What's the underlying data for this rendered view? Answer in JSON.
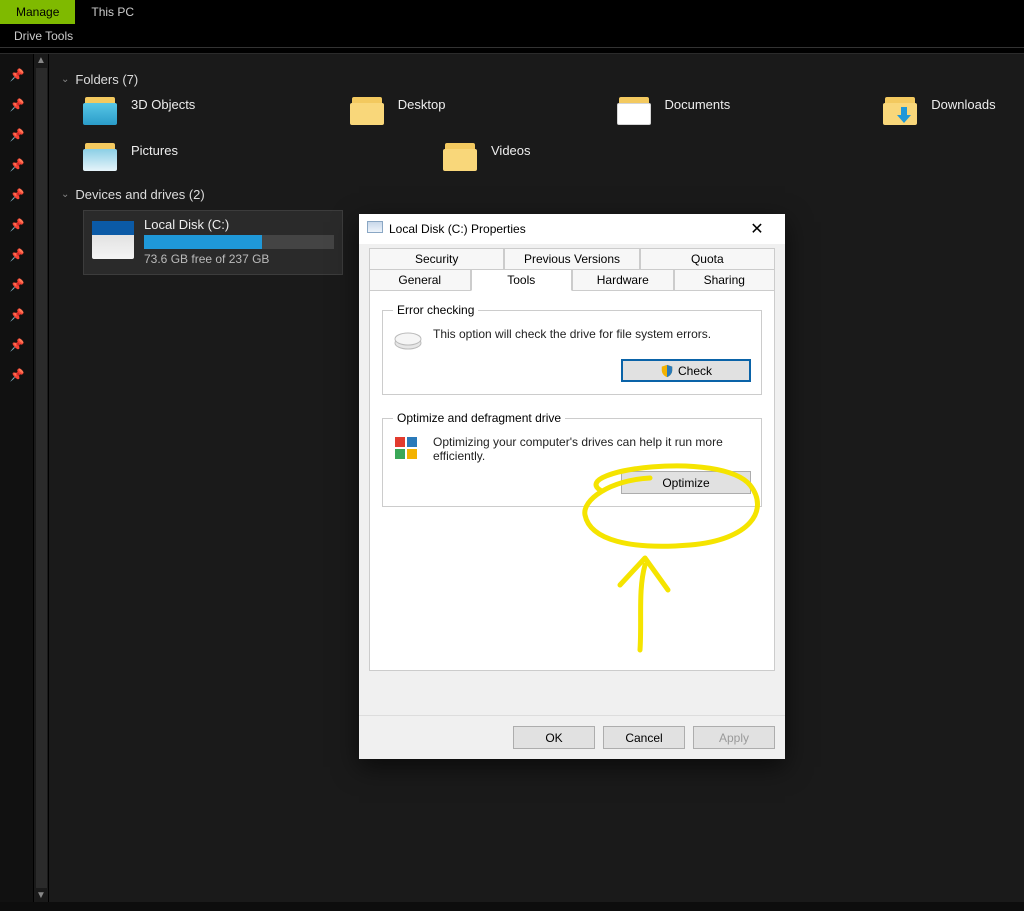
{
  "ribbon": {
    "tab_active": "Manage",
    "tab_context": "This PC",
    "sublabel": "Drive Tools"
  },
  "sections": {
    "folders_header": "Folders (7)",
    "drives_header": "Devices and drives (2)"
  },
  "folders": {
    "r1c1": "3D Objects",
    "r1c2": "Desktop",
    "r1c3": "Documents",
    "r1c4": "Downloads",
    "r2c1": "Pictures",
    "r2c2": "Videos"
  },
  "drive": {
    "name": "Local Disk (C:)",
    "subtext": "73.6 GB free of 237 GB"
  },
  "dialog": {
    "title": "Local Disk (C:) Properties",
    "tabs": {
      "security": "Security",
      "previous": "Previous Versions",
      "quota": "Quota",
      "general": "General",
      "tools": "Tools",
      "hardware": "Hardware",
      "sharing": "Sharing"
    },
    "error_group": {
      "legend": "Error checking",
      "text": "This option will check the drive for file system errors.",
      "button": "Check"
    },
    "optimize_group": {
      "legend": "Optimize and defragment drive",
      "text": "Optimizing your computer's drives can help it run more efficiently.",
      "button": "Optimize"
    },
    "buttons": {
      "ok": "OK",
      "cancel": "Cancel",
      "apply": "Apply"
    }
  }
}
